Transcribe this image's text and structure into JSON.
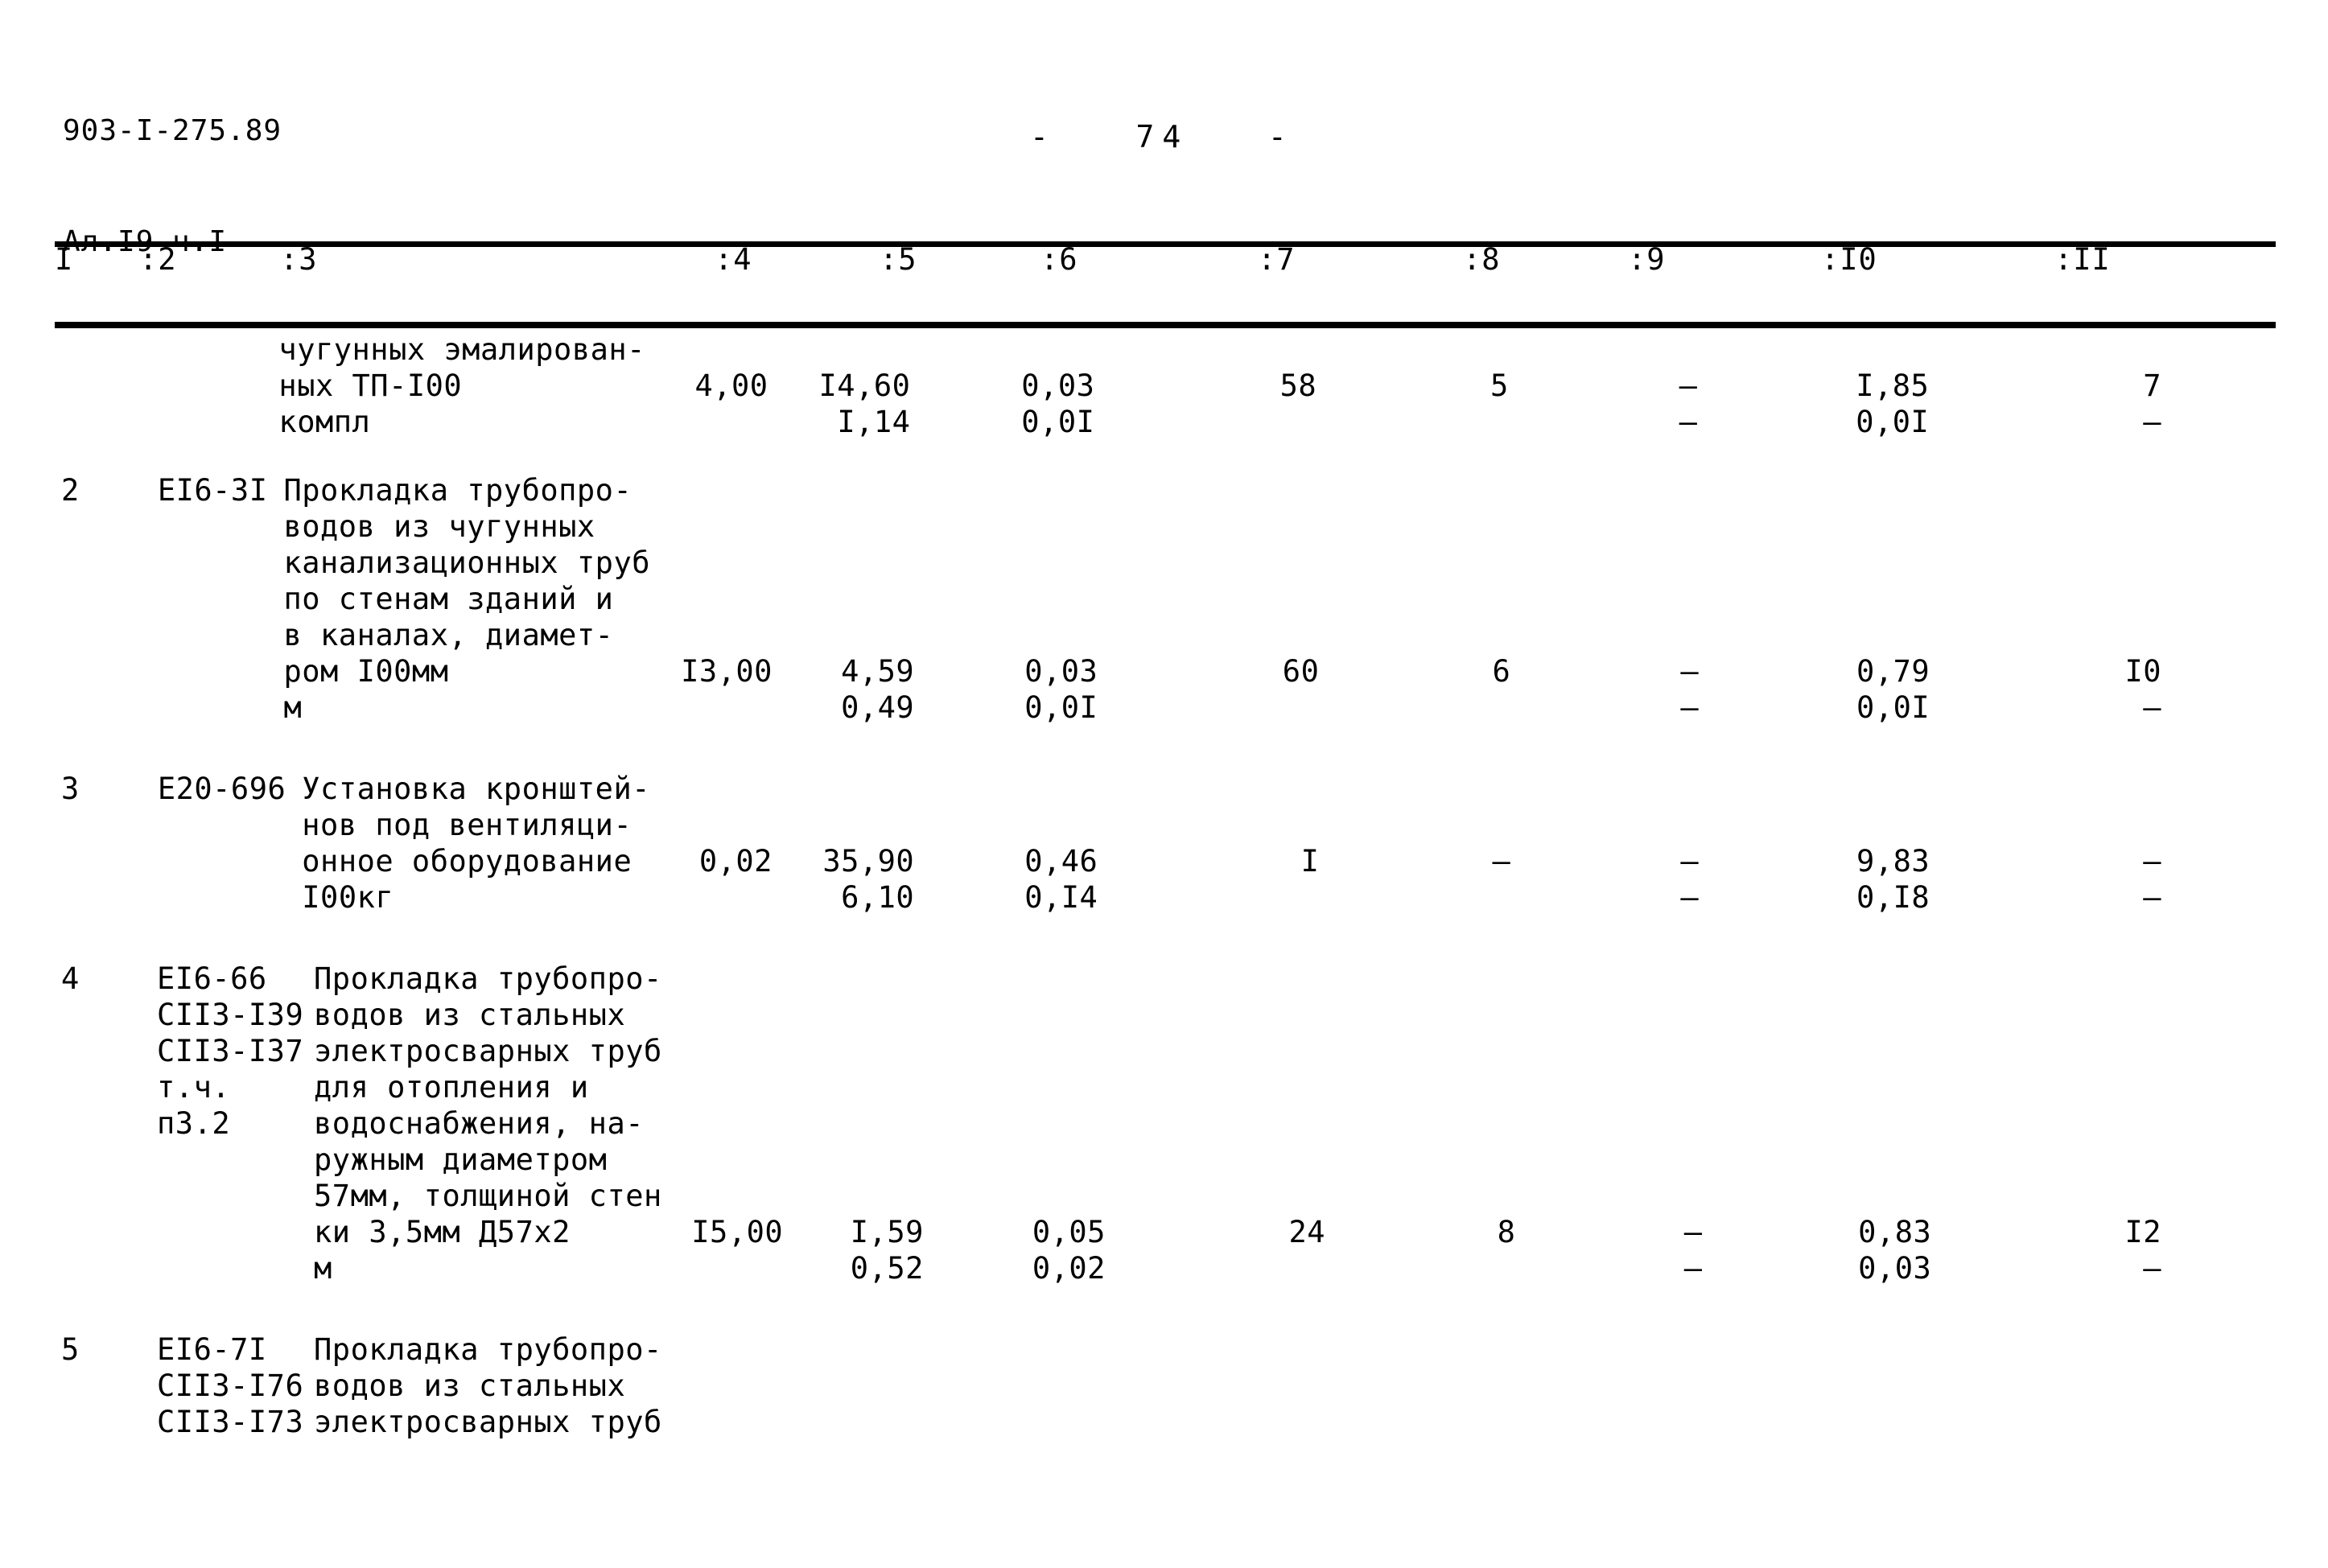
{
  "header": {
    "doc_code": "903-I-275.89",
    "album": "Ал.I9 ч.I",
    "page_marker": "-   74   -"
  },
  "table": {
    "column_headers": [
      "I",
      ":2",
      ":3",
      ":4",
      ":5",
      ":6",
      ":7",
      ":8",
      ":9",
      ":I0",
      ":II"
    ],
    "rows": [
      {
        "num": "",
        "code": "",
        "desc_lines": [
          "чугунных эмалирован-",
          "ных ТП-I00",
          "компл"
        ],
        "c4": "4,00",
        "c5_top": "I4,60",
        "c5_bot": "I,14",
        "c6_top": "0,03",
        "c6_bot": "0,0I",
        "c7_top": "58",
        "c7_bot": "",
        "c8_top": "5",
        "c8_bot": "",
        "c9_top": "–",
        "c9_bot": "–",
        "c10_top": "I,85",
        "c10_bot": "0,0I",
        "c11_top": "7",
        "c11_bot": "–",
        "value_line_index": 1
      },
      {
        "num": "2",
        "code": "EI6-3I",
        "desc_lines": [
          "Прокладка трубопро-",
          "водов из чугунных",
          "канализационных труб",
          "по стенам зданий и",
          "в каналах, диамет-",
          "ром I00мм",
          "м"
        ],
        "c4": "I3,00",
        "c5_top": "4,59",
        "c5_bot": "0,49",
        "c6_top": "0,03",
        "c6_bot": "0,0I",
        "c7_top": "60",
        "c7_bot": "",
        "c8_top": "6",
        "c8_bot": "",
        "c9_top": "–",
        "c9_bot": "–",
        "c10_top": "0,79",
        "c10_bot": "0,0I",
        "c11_top": "I0",
        "c11_bot": "–",
        "value_line_index": 5
      },
      {
        "num": "3",
        "code": "E20-696",
        "desc_lines": [
          "Установка кронштей-",
          "нов под вентиляци-",
          "онное оборудование",
          "I00кг"
        ],
        "c4": "0,02",
        "c5_top": "35,90",
        "c5_bot": "6,10",
        "c6_top": "0,46",
        "c6_bot": "0,I4",
        "c7_top": "I",
        "c7_bot": "",
        "c8_top": "–",
        "c8_bot": "",
        "c9_top": "–",
        "c9_bot": "–",
        "c10_top": "9,83",
        "c10_bot": "0,I8",
        "c11_top": "–",
        "c11_bot": "–",
        "value_line_index": 2
      },
      {
        "num": "4",
        "code": "EI6-66\nCII3-I39\nCII3-I37\nт.ч.\nп3.2",
        "desc_lines": [
          "Прокладка трубопро-",
          "водов из стальных",
          "электросварных труб",
          "для отопления и",
          "водоснабжения, на-",
          "ружным диаметром",
          "57мм, толщиной стен",
          "ки 3,5мм Д57х2",
          "м"
        ],
        "c4": "I5,00",
        "c5_top": "I,59",
        "c5_bot": "0,52",
        "c6_top": "0,05",
        "c6_bot": "0,02",
        "c7_top": "24",
        "c7_bot": "",
        "c8_top": "8",
        "c8_bot": "",
        "c9_top": "–",
        "c9_bot": "–",
        "c10_top": "0,83",
        "c10_bot": "0,03",
        "c11_top": "I2",
        "c11_bot": "–",
        "value_line_index": 7
      },
      {
        "num": "5",
        "code": "EI6-7I\nCII3-I76\nCII3-I73",
        "desc_lines": [
          "Прокладка трубопро-",
          "водов из стальных",
          "электросварных труб"
        ],
        "c4": "",
        "c5_top": "",
        "c5_bot": "",
        "c6_top": "",
        "c6_bot": "",
        "c7_top": "",
        "c7_bot": "",
        "c8_top": "",
        "c8_bot": "",
        "c9_top": "",
        "c9_bot": "",
        "c10_top": "",
        "c10_bot": "",
        "c11_top": "",
        "c11_bot": "",
        "value_line_index": -1
      }
    ]
  }
}
